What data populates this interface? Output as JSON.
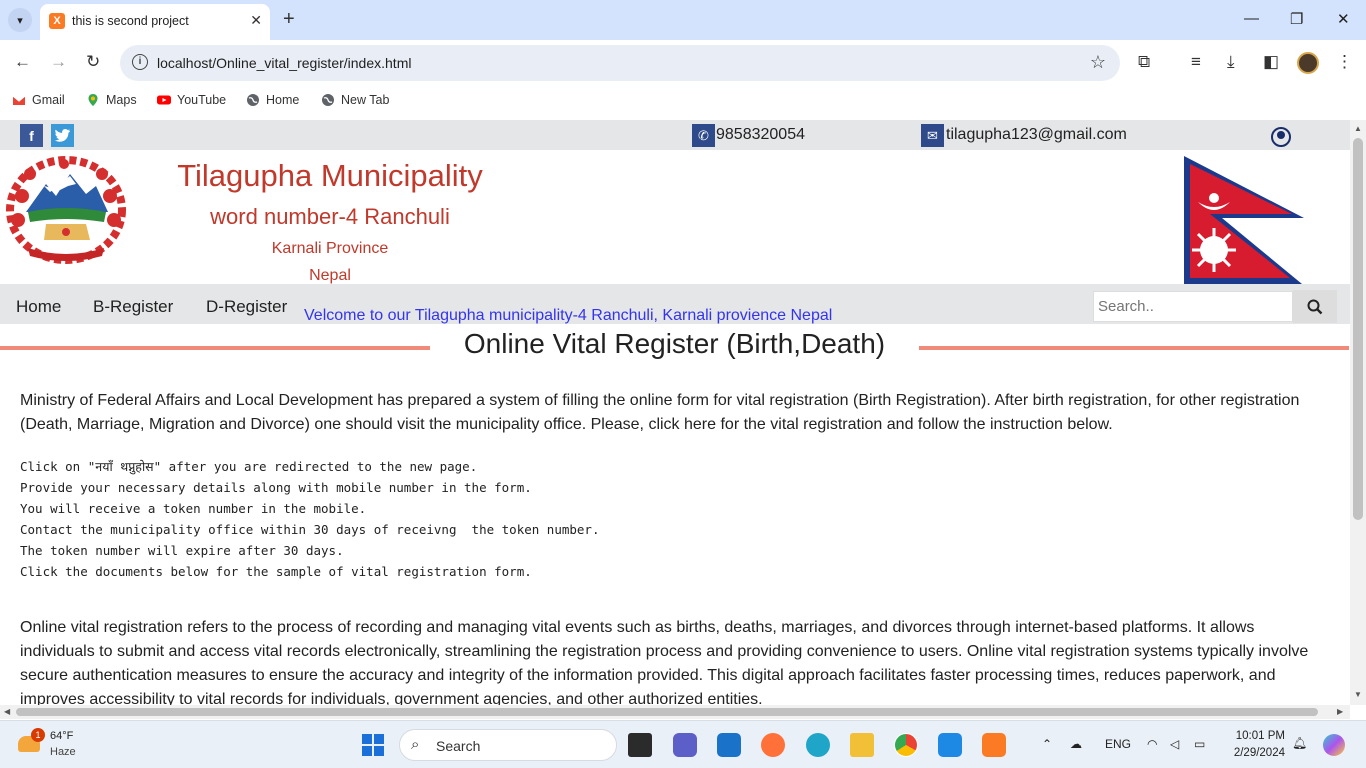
{
  "browser": {
    "tab_title": "this is second project",
    "url": "localhost/Online_vital_register/index.html",
    "bookmarks": [
      "Gmail",
      "Maps",
      "YouTube",
      "Home",
      "New Tab"
    ]
  },
  "site": {
    "phone": "9858320054",
    "email": "tilagupha123@gmail.com",
    "header": {
      "title": "Tilagupha Municipality",
      "ward": "word number-4 Ranchuli",
      "province": "Karnali Province",
      "country": "Nepal"
    },
    "nav": [
      "Home",
      "B-Register",
      "D-Register"
    ],
    "marquee": "Velcome to our Tilagupha municipality-4 Ranchuli, Karnali provience Nepal",
    "search_placeholder": "Search..",
    "section_title": "Online Vital Register (Birth,Death)",
    "intro": "Ministry of Federal Affairs and Local Development has prepared a system of filling the online form for vital registration (Birth Registration). After birth registration, for other registration (Death, Marriage, Migration and Divorce) one should visit the municipality office. Please, click here for the vital registration and follow the instruction below.",
    "steps": [
      "Click on \"नयाँ थप्नुहोस\" after you are redirected to the new page.",
      "Provide your necessary details along with mobile number in the form.",
      "You will receive a token number in the mobile.",
      "Contact the municipality office within 30 days of receivng  the token number.",
      "The token number will expire after 30 days.",
      "Click the documents below for the sample of vital registration form."
    ],
    "description": "Online vital registration refers to the process of recording and managing vital events such as births, deaths, marriages, and divorces through internet-based platforms. It allows individuals to submit and access vital records electronically, streamlining the registration process and providing convenience to users. Online vital registration systems typically involve secure authentication measures to ensure the accuracy and integrity of the information provided. This digital approach facilitates faster processing times, reduces paperwork, and improves accessibility to vital records for individuals, government agencies, and other authorized entities."
  },
  "taskbar": {
    "weather_temp": "64°F",
    "weather_cond": "Haze",
    "weather_badge": "1",
    "search_label": "Search",
    "lang": "ENG",
    "time": "10:01 PM",
    "date": "2/29/2024"
  },
  "colors": {
    "title_red": "#c0392b",
    "marquee_blue": "#3434f0",
    "section_line": "#f08a7a",
    "facebook": "#3b5998",
    "twitter": "#3c99d8"
  }
}
